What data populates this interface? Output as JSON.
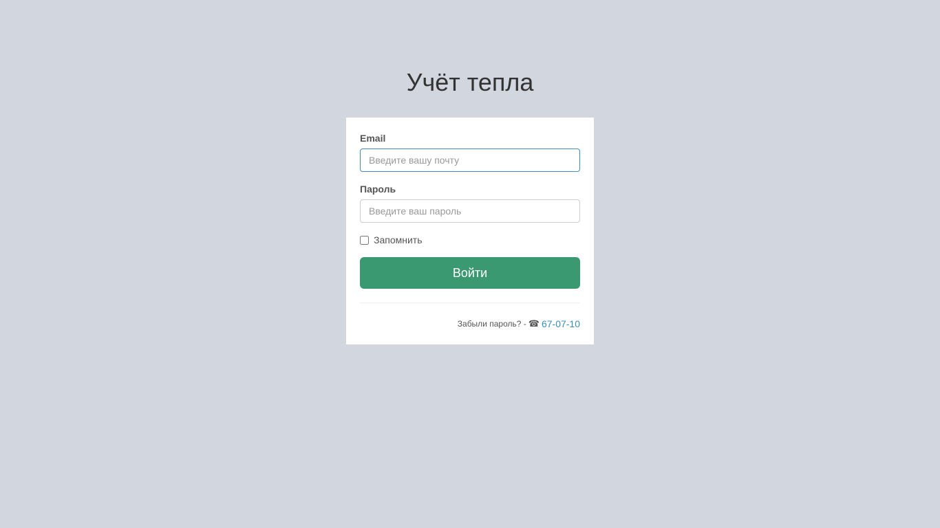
{
  "page": {
    "title": "Учёт тепла"
  },
  "form": {
    "email": {
      "label": "Email",
      "value": "",
      "placeholder": "Введите вашу почту"
    },
    "password": {
      "label": "Пароль",
      "value": "",
      "placeholder": "Введите ваш пароль"
    },
    "remember": {
      "label": "Запомнить",
      "checked": false
    },
    "submit_label": "Войти"
  },
  "footer": {
    "forgot_text": "Забыли пароль? -",
    "phone_icon": "☎",
    "phone_number": "67-07-10"
  },
  "colors": {
    "background": "#d2d6de",
    "button": "#3b9971",
    "link": "#3c8dbc",
    "focus_border": "#3c8dbc"
  },
  "icons": {
    "phone": "phone-icon"
  }
}
